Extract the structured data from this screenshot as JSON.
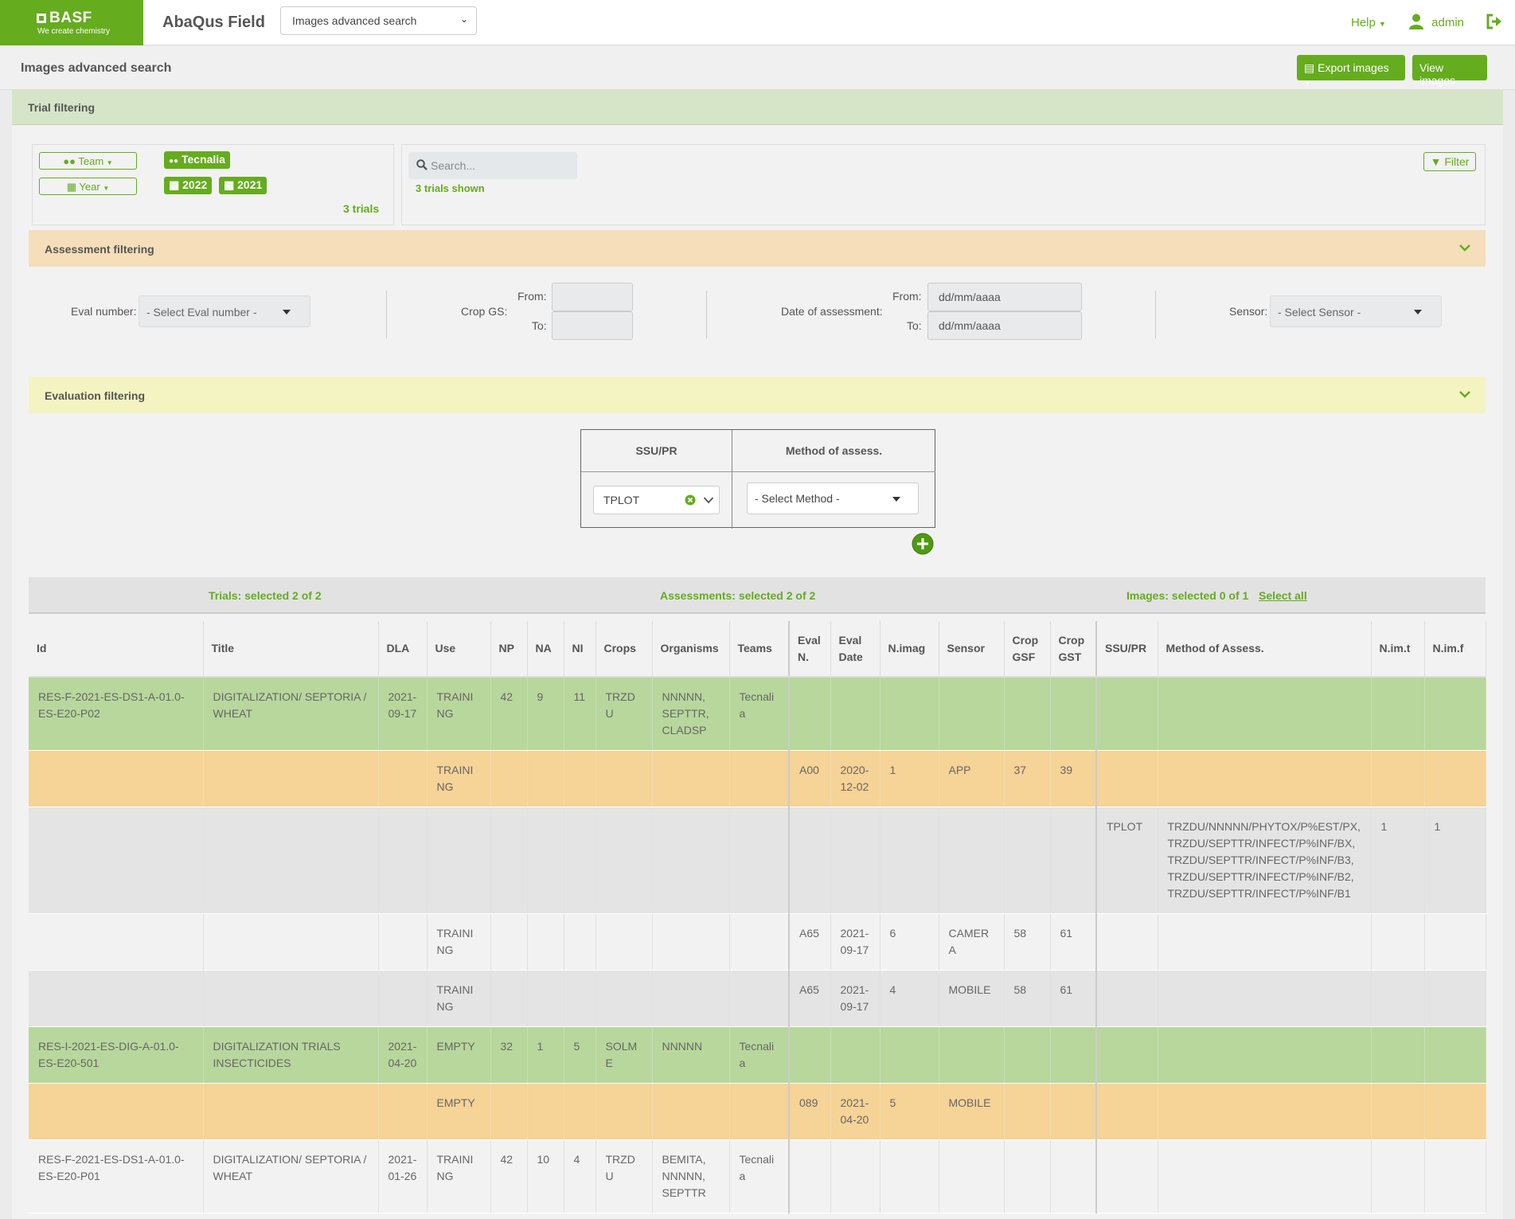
{
  "topbar": {
    "logo_brand": "BASF",
    "logo_tagline": "We create chemistry",
    "app_title": "AbaQus Field",
    "page_select_value": "Images advanced search",
    "help_label": "Help",
    "user_label": "admin"
  },
  "subbar": {
    "title": "Images advanced search",
    "export_label": "Export images",
    "view_label": "View images"
  },
  "trial": {
    "title": "Trial filtering",
    "team_filter": "Team",
    "year_filter": "Year",
    "team_selected": "Tecnalia",
    "years_selected": [
      "2022",
      "2021"
    ],
    "trials_count": "3 trials",
    "search_placeholder": "Search...",
    "shown": "3 trials shown",
    "filter_label": "Filter"
  },
  "assessment": {
    "title": "Assessment filtering",
    "eval_label": "Eval number:",
    "eval_placeholder": "- Select Eval number -",
    "crop_gs_label": "Crop GS:",
    "from_label": "From:",
    "to_label": "To:",
    "date_label": "Date of assessment:",
    "date_placeholder": "dd/mm/aaaa",
    "sensor_label": "Sensor:",
    "sensor_placeholder": "- Select Sensor -"
  },
  "evaluation": {
    "title": "Evaluation filtering",
    "col_ssu": "SSU/PR",
    "col_method": "Method of assess.",
    "ssu_value": "TPLOT",
    "method_placeholder": "- Select Method -"
  },
  "summary": {
    "trials": "Trials: selected 2 of 2",
    "assessments": "Assessments: selected 2 of 2",
    "images": "Images: selected 0 of 1",
    "select_all": "Select all"
  },
  "table": {
    "headers": [
      "Id",
      "Title",
      "DLA",
      "Use",
      "NP",
      "NA",
      "NI",
      "Crops",
      "Organisms",
      "Teams",
      "Eval N.",
      "Eval Date",
      "N.imag",
      "Sensor",
      "Crop GSF",
      "Crop GST",
      "SSU/PR",
      "Method of Assess.",
      "N.im.t",
      "N.im.f"
    ],
    "rows": [
      {
        "type": "green",
        "cells": [
          "RES-F-2021-ES-DS1-A-01.0-ES-E20-P02",
          "DIGITALIZATION/ SEPTORIA / WHEAT",
          "2021-09-17",
          "TRAINING",
          "42",
          "9",
          "11",
          "TRZDU",
          "NNNNN, SEPTTR, CLADSP",
          "Tecnalia",
          "",
          "",
          "",
          "",
          "",
          "",
          "",
          "",
          "",
          ""
        ]
      },
      {
        "type": "orange",
        "cells": [
          "",
          "",
          "",
          "TRAINING",
          "",
          "",
          "",
          "",
          "",
          "",
          "A00",
          "2020-12-02",
          "1",
          "APP",
          "37",
          "39",
          "",
          "",
          "",
          ""
        ]
      },
      {
        "type": "gray",
        "cells": [
          "",
          "",
          "",
          "",
          "",
          "",
          "",
          "",
          "",
          "",
          "",
          "",
          "",
          "",
          "",
          "",
          "TPLOT",
          "TRZDU/NNNNN/PHYTOX/P%EST/PX, TRZDU/SEPTTR/INFECT/P%INF/BX, TRZDU/SEPTTR/INFECT/P%INF/B3, TRZDU/SEPTTR/INFECT/P%INF/B2, TRZDU/SEPTTR/INFECT/P%INF/B1",
          "1",
          "1"
        ]
      },
      {
        "type": "white",
        "cells": [
          "",
          "",
          "",
          "TRAINING",
          "",
          "",
          "",
          "",
          "",
          "",
          "A65",
          "2021-09-17",
          "6",
          "CAMERA",
          "58",
          "61",
          "",
          "",
          "",
          ""
        ]
      },
      {
        "type": "gray",
        "cells": [
          "",
          "",
          "",
          "TRAINING",
          "",
          "",
          "",
          "",
          "",
          "",
          "A65",
          "2021-09-17",
          "4",
          "MOBILE",
          "58",
          "61",
          "",
          "",
          "",
          ""
        ]
      },
      {
        "type": "green",
        "cells": [
          "RES-I-2021-ES-DIG-A-01.0-ES-E20-501",
          "DIGITALIZATION TRIALS INSECTICIDES",
          "2021-04-20",
          "EMPTY",
          "32",
          "1",
          "5",
          "SOLME",
          "NNNNN",
          "Tecnalia",
          "",
          "",
          "",
          "",
          "",
          "",
          "",
          "",
          "",
          ""
        ]
      },
      {
        "type": "orange",
        "cells": [
          "",
          "",
          "",
          "EMPTY",
          "",
          "",
          "",
          "",
          "",
          "",
          "089",
          "2021-04-20",
          "5",
          "MOBILE",
          "",
          "",
          "",
          "",
          "",
          ""
        ]
      },
      {
        "type": "white",
        "cells": [
          "RES-F-2021-ES-DS1-A-01.0-ES-E20-P01",
          "DIGITALIZATION/ SEPTORIA / WHEAT",
          "2021-01-26",
          "TRAINING",
          "42",
          "10",
          "4",
          "TRZDU",
          "BEMITA, NNNNN, SEPTTR",
          "Tecnalia",
          "",
          "",
          "",
          "",
          "",
          "",
          "",
          "",
          "",
          ""
        ]
      }
    ]
  }
}
